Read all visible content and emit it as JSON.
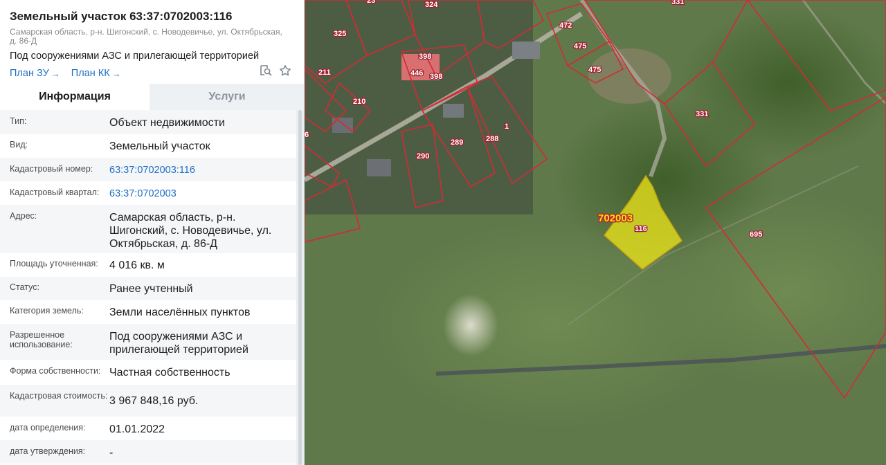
{
  "parcel": {
    "title": "Земельный участок 63:37:0702003:116",
    "address": "Самарская область, р-н. Шигонский, с. Новодевичье, ул. Октябрьская, д. 86-Д",
    "purpose": "Под сооружениями АЗС и прилегающей территорией",
    "plan_zu": "План ЗУ",
    "plan_kk": "План КК",
    "arrow": "→"
  },
  "icons": {
    "search_doc": "search-document-icon",
    "star": "star-icon"
  },
  "tabs": {
    "info": "Информация",
    "services": "Услуги"
  },
  "rows": [
    {
      "label": "Тип:",
      "value": "Объект недвижимости"
    },
    {
      "label": "Вид:",
      "value": "Земельный участок"
    },
    {
      "label": "Кадастровый номер:",
      "value": "63:37:0702003:116"
    },
    {
      "label": "Кадастровый квартал:",
      "value": "63:37:0702003"
    },
    {
      "label": "Адрес:",
      "value": "Самарская область, р-н. Шигонский, с. Новодевичье, ул. Октябрьская, д. 86-Д"
    },
    {
      "label": "Площадь уточненная:",
      "value": "4 016 кв. м"
    },
    {
      "label": "Статус:",
      "value": "Ранее учтенный"
    },
    {
      "label": "Категория земель:",
      "value": "Земли населённых пунктов"
    },
    {
      "label": "Разрешенное использование:",
      "value": "Под сооружениями АЗС и прилегающей территорией"
    },
    {
      "label": "Форма собственности:",
      "value": "Частная собственность"
    },
    {
      "label": "Кадастровая стоимость:",
      "value": "3 967 848,16 руб."
    },
    {
      "label": "дата определения:",
      "value": "01.01.2022"
    },
    {
      "label": "дата утверждения:",
      "value": "-"
    }
  ],
  "map": {
    "quarter_label": "702003",
    "selected_label": "116",
    "parcel_labels": [
      "324",
      "331",
      "325",
      "472",
      "475",
      "475",
      "398",
      "446",
      "398",
      "211",
      "210",
      "331",
      "1",
      "289",
      "288",
      "290",
      "695",
      "6",
      "23"
    ],
    "colors": {
      "boundary": "#d42a35",
      "selected_fill": "#e8e21a",
      "quarter_label": "#f5e400"
    }
  }
}
